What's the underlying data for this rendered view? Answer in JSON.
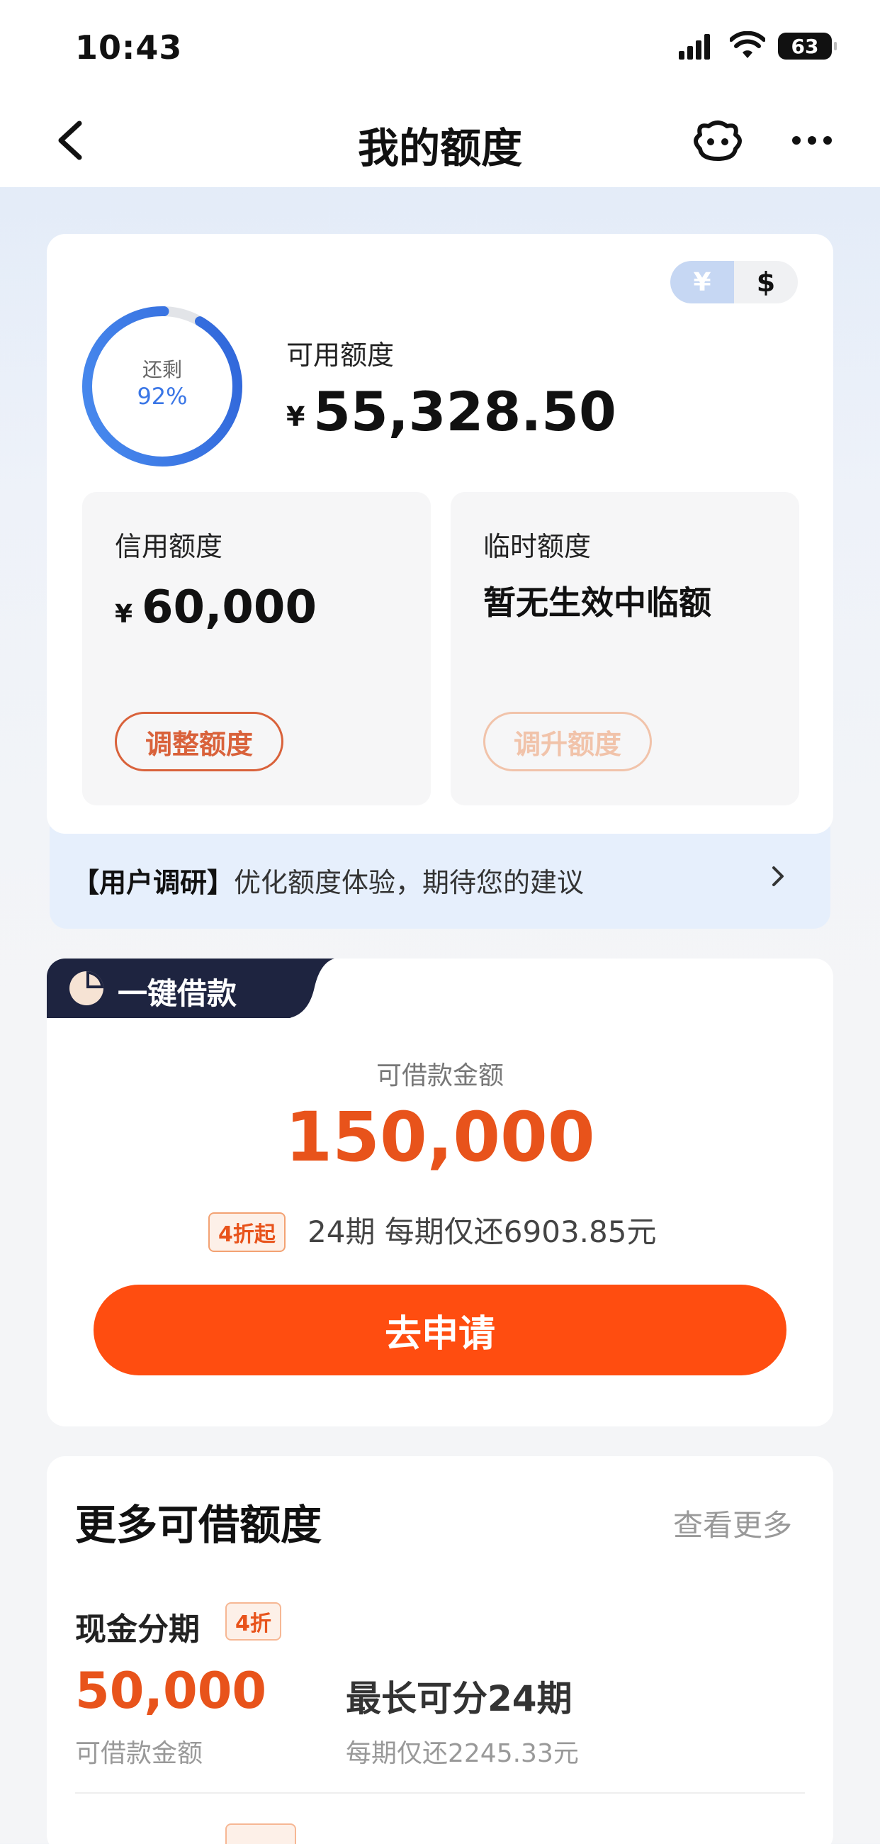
{
  "status_bar": {
    "time": "10:43",
    "battery": "63"
  },
  "nav": {
    "title": "我的额度"
  },
  "summary": {
    "currency_toggle": {
      "cny": "¥",
      "usd": "$",
      "active": "cny"
    },
    "ring": {
      "label": "还剩",
      "percent_text": "92%",
      "remaining_fraction": 0.92
    },
    "available_label": "可用额度",
    "available_currency": "¥",
    "available_value": "55,328.50",
    "credit": {
      "title": "信用额度",
      "currency": "¥",
      "value": "60,000",
      "button": "调整额度"
    },
    "temp": {
      "title": "临时额度",
      "status": "暂无生效中临额",
      "button": "调升额度"
    }
  },
  "survey": {
    "tag": "【用户调研】",
    "text": "优化额度体验，期待您的建议"
  },
  "quick_loan": {
    "tag": "一键借款",
    "amount_label": "可借款金额",
    "amount": "150,000",
    "discount": "4折起",
    "terms": "24期  每期仅还6903.85元",
    "apply_button": "去申请"
  },
  "more_credit": {
    "title": "更多可借额度",
    "more_link": "查看更多",
    "product": {
      "name": "现金分期",
      "discount": "4折",
      "amount": "50,000",
      "amount_label": "可借款金额",
      "term": "最长可分24期",
      "payment": "每期仅还2245.33元"
    }
  },
  "colors": {
    "accent": "#ff4d10",
    "amount": "#e8531b",
    "ring": "#3a76e6",
    "tag_bg": "#1e2440"
  }
}
